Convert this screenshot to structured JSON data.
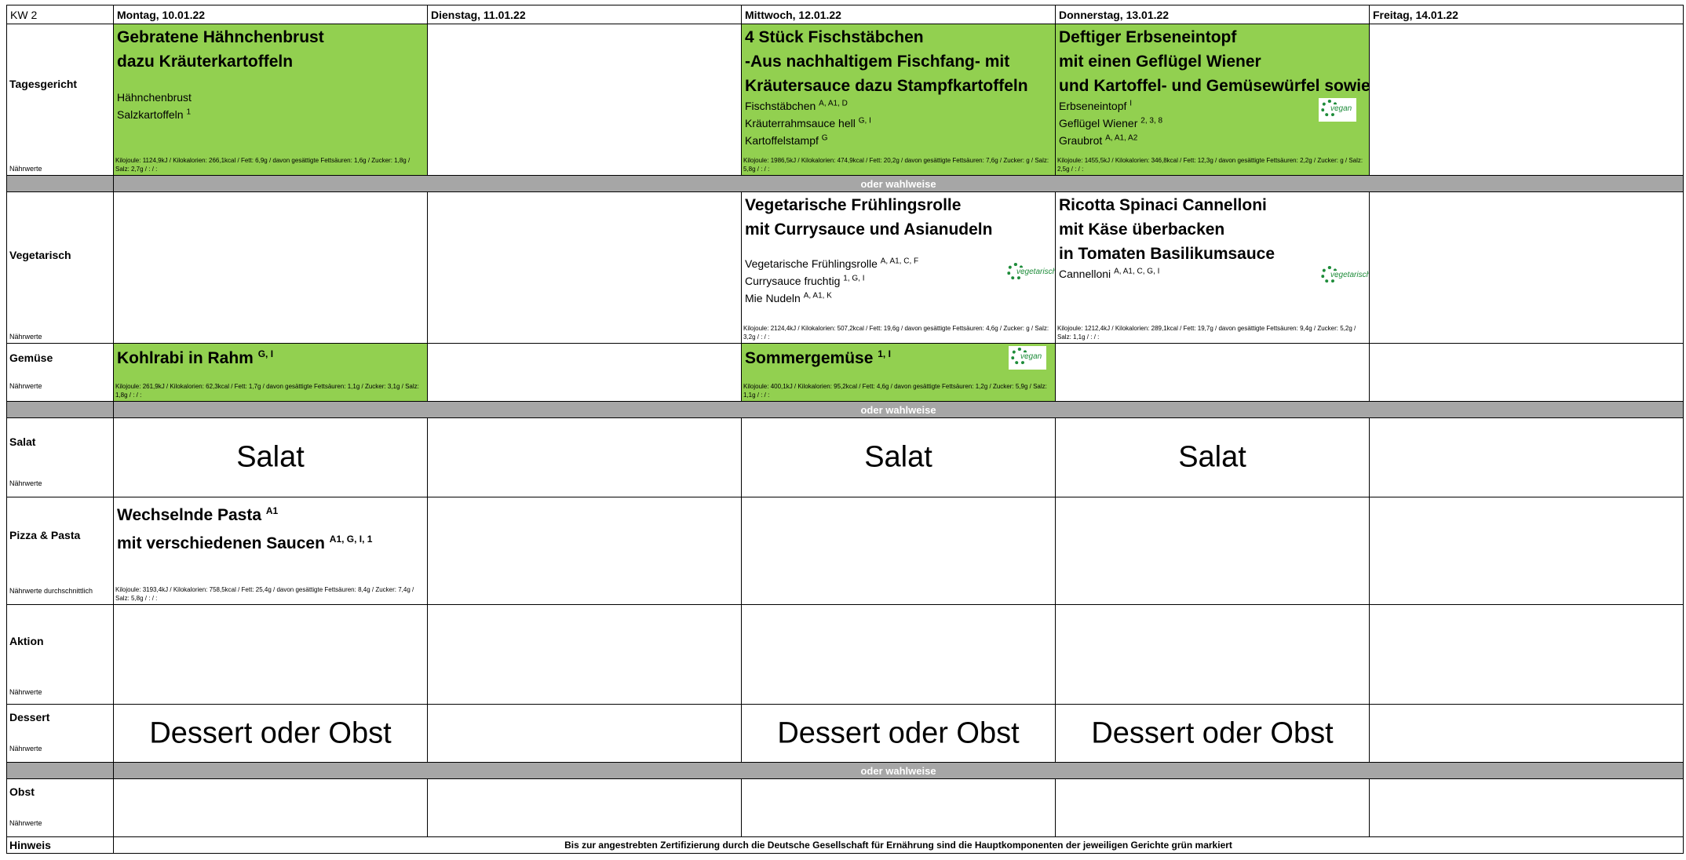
{
  "header": {
    "kw": "KW 2",
    "days": [
      "Montag, 10.01.22",
      "Dienstag, 11.01.22",
      "Mittwoch, 12.01.22",
      "Donnerstag, 13.01.22",
      "Freitag, 14.01.22"
    ]
  },
  "separator": "oder wahlweise",
  "rows": {
    "tagesgericht": {
      "label": "Tagesgericht",
      "nw": "Nährwerte",
      "mo": {
        "title1": "Gebratene Hähnchenbrust",
        "title2": "dazu Kräuterkartoffeln",
        "c1": "Hähnchenbrust",
        "c2": "Salzkartoffeln",
        "c2sup": "1",
        "nutri": "Kilojoule: 1124,9kJ / Kilokalorien: 266,1kcal / Fett: 6,9g / davon gesättigte Fettsäuren: 1,6g / Zucker: 1,8g / Salz: 2,7g / : / :"
      },
      "mi": {
        "title1": "4 Stück Fischstäbchen",
        "title2": "-Aus nachhaltigem Fischfang- mit",
        "title3": "Kräutersauce dazu Stampfkartoffeln",
        "c1": "Fischstäbchen",
        "c1sup": "A, A1, D",
        "c2": "Kräuterrahmsauce hell",
        "c2sup": "G, I",
        "c3": "Kartoffelstampf",
        "c3sup": "G",
        "nutri": "Kilojoule: 1986,5kJ / Kilokalorien: 474,9kcal / Fett: 20,2g / davon gesättigte Fettsäuren: 7,6g / Zucker: g / Salz: 5,8g / : / :"
      },
      "do": {
        "title1": "Deftiger Erbseneintopf",
        "title2": "mit einen Geflügel Wiener",
        "title3": "und Kartoffel- und Gemüsewürfel sowie",
        "c1": "Erbseneintopf",
        "c1sup": "I",
        "c2": "Geflügel Wiener",
        "c2sup": "2, 3, 8",
        "c3": "Graubrot",
        "c3sup": "A, A1, A2",
        "badge": "vegan",
        "nutri": "Kilojoule: 1455,5kJ / Kilokalorien: 346,8kcal / Fett: 12,3g / davon gesättigte Fettsäuren: 2,2g / Zucker: g / Salz: 2,5g / : / :"
      }
    },
    "vegetarisch": {
      "label": "Vegetarisch",
      "nw": "Nährwerte",
      "mi": {
        "title1": "Vegetarische Frühlingsrolle",
        "title2": "mit Currysauce und Asianudeln",
        "c1": "Vegetarische Frühlingsrolle",
        "c1sup": "A, A1, C, F",
        "c2": "Currysauce fruchtig",
        "c2sup": "1, G, I",
        "c3": "Mie Nudeln",
        "c3sup": "A, A1, K",
        "badge": "vegetarisch",
        "nutri": "Kilojoule: 2124,4kJ / Kilokalorien: 507,2kcal / Fett: 19,6g / davon gesättigte Fettsäuren: 4,6g / Zucker: g / Salz: 3,2g / : / :"
      },
      "do": {
        "title1": "Ricotta Spinaci Cannelloni",
        "title2": "mit Käse überbacken",
        "title3": "in Tomaten Basilikumsauce",
        "c1": "Cannelloni",
        "c1sup": "A, A1, C, G, I",
        "badge": "vegetarisch",
        "nutri": "Kilojoule: 1212,4kJ / Kilokalorien: 289,1kcal / Fett: 19,7g / davon gesättigte Fettsäuren: 9,4g / Zucker: 5,2g / Salz: 1,1g / : / :"
      }
    },
    "gemuese": {
      "label": "Gemüse",
      "nw": "Nährwerte",
      "mo": {
        "title1": "Kohlrabi in Rahm",
        "t1sup": "G, I",
        "nutri": "Kilojoule: 261,9kJ / Kilokalorien: 62,3kcal / Fett: 1,7g / davon gesättigte Fettsäuren: 1,1g / Zucker: 3,1g / Salz: 1,8g / : / :"
      },
      "mi": {
        "title1": "Sommergemüse",
        "t1sup": "1, I",
        "badge": "vegan",
        "nutri": "Kilojoule: 400,1kJ / Kilokalorien: 95,2kcal / Fett: 4,6g / davon gesättigte Fettsäuren: 1,2g / Zucker: 5,9g / Salz: 1,1g / : / :"
      }
    },
    "salat": {
      "label": "Salat",
      "nw": "Nährwerte",
      "mo": "Salat",
      "mi": "Salat",
      "do": "Salat"
    },
    "pizza": {
      "label": "Pizza & Pasta",
      "nw": "Nährwerte durchschnittlich",
      "mo": {
        "title1": "Wechselnde Pasta",
        "t1sup": "A1",
        "title2": "mit verschiedenen Saucen",
        "t2sup": "A1, G, I, 1",
        "nutri": "Kilojoule: 3193,4kJ / Kilokalorien: 758,5kcal / Fett: 25,4g / davon gesättigte Fettsäuren: 8,4g / Zucker: 7,4g / Salz: 5,8g / : / :"
      }
    },
    "aktion": {
      "label": "Aktion",
      "nw": "Nährwerte"
    },
    "dessert": {
      "label": "Dessert",
      "nw": "Nährwerte",
      "mo": "Dessert oder Obst",
      "mi": "Dessert oder Obst",
      "do": "Dessert oder Obst"
    },
    "obst": {
      "label": "Obst",
      "nw": "Nährwerte"
    },
    "hinweis": {
      "label": "Hinweis",
      "text": "Bis zur angestrebten Zertifizierung durch die Deutsche Gesellschaft für Ernährung sind die Hauptkomponenten der jeweiligen Gerichte grün markiert"
    }
  },
  "colors": {
    "highlight": "#92d050",
    "separator": "#a6a6a6",
    "badge": "#1e8c3a"
  }
}
